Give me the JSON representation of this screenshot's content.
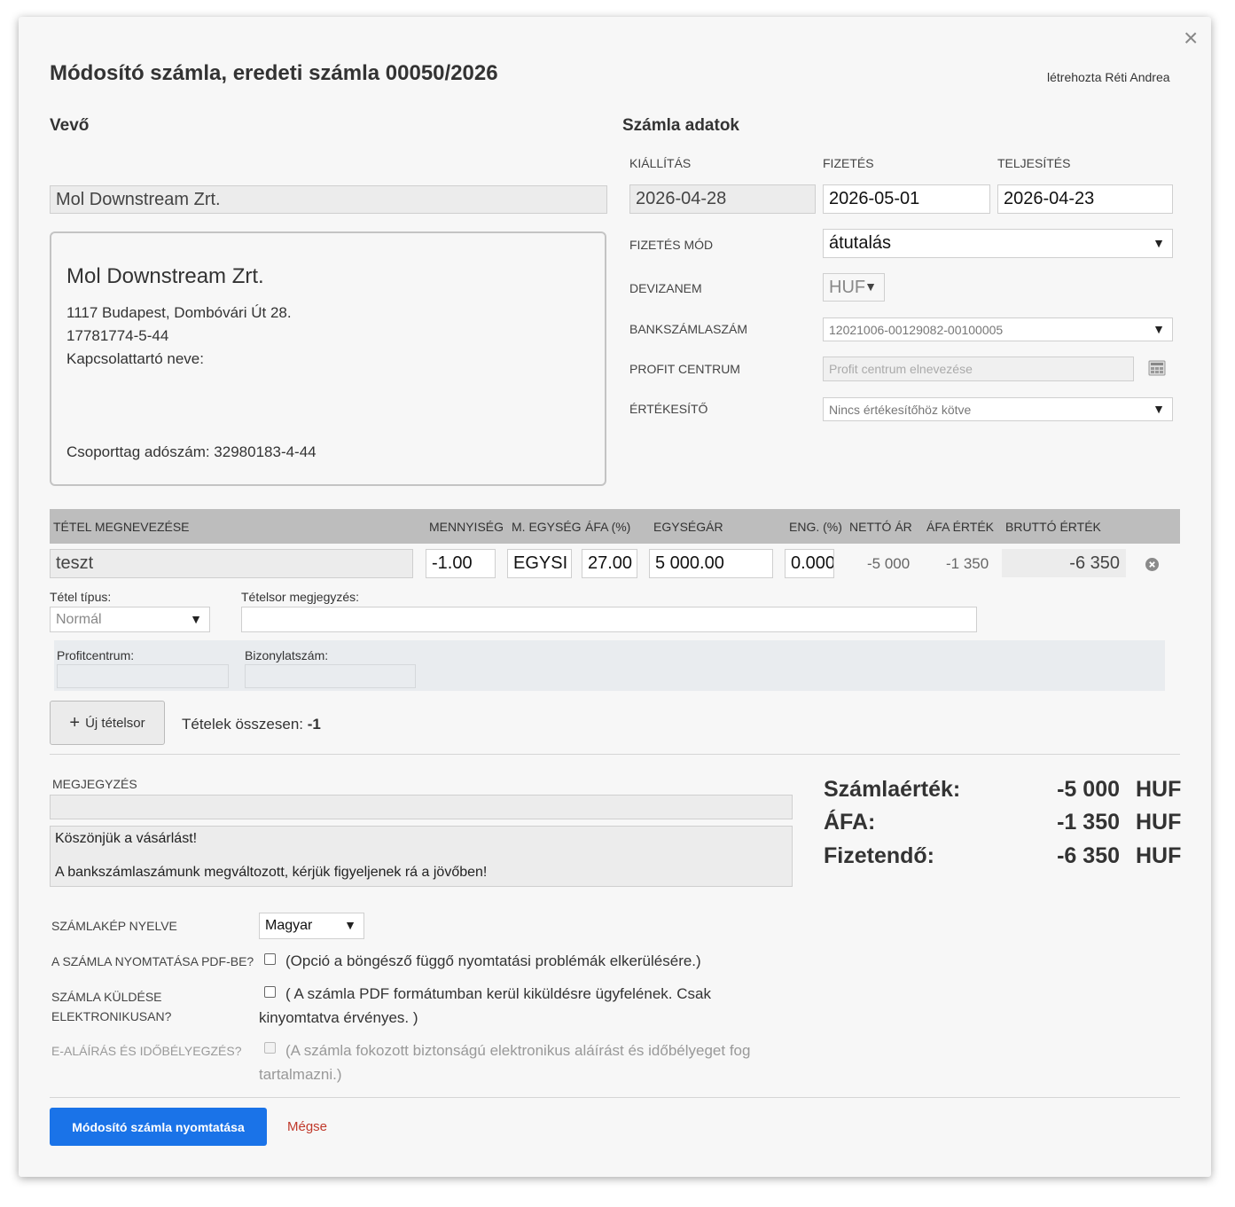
{
  "title": "Módosító számla, eredeti számla 00050/2026",
  "created_by": "létrehozta Réti Andrea",
  "buyer": {
    "heading": "Vevő",
    "name_input": "Mol Downstream Zrt.",
    "card": {
      "name": "Mol Downstream Zrt.",
      "address": "1117 Budapest, Dombóvári Út 28.",
      "tax_id": "17781774-5-44",
      "contact": "Kapcsolattartó neve:",
      "group_tax": "Csoporttag adószám: 32980183-4-44"
    }
  },
  "invoice": {
    "heading": "Számla adatok",
    "issue_label": "KIÁLLÍTÁS",
    "payment_label": "FIZETÉS",
    "fulfillment_label": "TELJESÍTÉS",
    "issue_date": "2026-04-28",
    "payment_date": "2026-05-01",
    "fulfillment_date": "2026-04-23",
    "payment_method_label": "FIZETÉS MÓD",
    "payment_method": "átutalás",
    "currency_label": "DEVIZANEM",
    "currency": "HUF",
    "bank_label": "BANKSZÁMLASZÁM",
    "bank_account": "12021006-00129082-00100005",
    "profit_label": "PROFIT CENTRUM",
    "profit_placeholder": "Profit centrum elnevezése",
    "seller_label": "ÉRTÉKESÍTŐ",
    "seller": "Nincs értékesítőhöz kötve"
  },
  "items": {
    "headers": {
      "name": "TÉTEL MEGNEVEZÉSE",
      "qty": "MENNYISÉG",
      "unit": "M. EGYSÉG",
      "vat": "ÁFA (%)",
      "unit_price": "EGYSÉGÁR",
      "discount": "ENG. (%)",
      "net": "NETTÓ ÁR",
      "vat_value": "ÁFA ÉRTÉK",
      "gross": "BRUTTÓ ÉRTÉK"
    },
    "row": {
      "name": "teszt",
      "qty": "-1.00",
      "unit": "EGYSI",
      "vat": "27.00",
      "unit_price": "5 000.00",
      "discount": "0.000",
      "net": "-5 000",
      "vat_value": "-1 350",
      "gross": "-6 350"
    },
    "type_label": "Tétel típus:",
    "type_value": "Normál",
    "note_label": "Tételsor megjegyzés:",
    "profitcenter_label": "Profitcentrum:",
    "voucher_label": "Bizonylatszám:",
    "new_row_button": "Új tételsor",
    "total_label": "Tételek összesen:",
    "total_value": "-1"
  },
  "note": {
    "label": "MEGJEGYZÉS",
    "line1": "Köszönjük a vásárlást!",
    "line2": "A bankszámlaszámunk megváltozott, kérjük figyeljenek rá a jövőben!"
  },
  "summary": {
    "invoice_value_label": "Számlaérték:",
    "invoice_value": "-5 000",
    "vat_label": "ÁFA:",
    "vat_value": "-1 350",
    "payable_label": "Fizetendő:",
    "payable_value": "-6 350",
    "currency": "HUF"
  },
  "options": {
    "language_label": "SZÁMLAKÉP NYELVE",
    "language": "Magyar",
    "pdf_label": "A SZÁMLA NYOMTATÁSA PDF-BE?",
    "pdf_desc": "(Opció a böngésző függő nyomtatási problémák elkerülésére.)",
    "electronic_label_1": "SZÁMLA KÜLDÉSE",
    "electronic_label_2": "ELEKTRONIKUSAN?",
    "electronic_desc_1": "( A számla PDF formátumban kerül kiküldésre ügyfelének. Csak",
    "electronic_desc_2": "kinyomtatva érvényes. )",
    "esign_label": "E-ALÁÍRÁS ÉS IDŐBÉLYEGZÉS?",
    "esign_desc_1": "(A számla fokozott biztonságú elektronikus aláírást és időbélyeget fog",
    "esign_desc_2": "tartalmazni.)"
  },
  "actions": {
    "print": "Módosító számla nyomtatása",
    "cancel": "Mégse"
  }
}
